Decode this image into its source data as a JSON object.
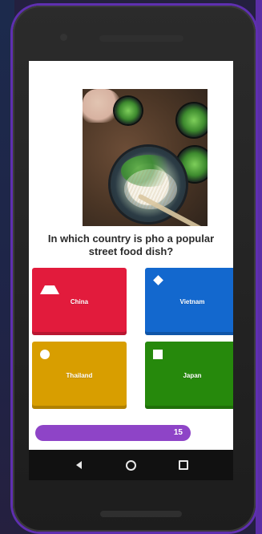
{
  "question": {
    "text": "In which country is pho a popular street food dish?"
  },
  "answers": [
    {
      "label": "China",
      "shape": "triangle",
      "color": "#e21b3c"
    },
    {
      "label": "Vietnam",
      "shape": "diamond",
      "color": "#1368ce"
    },
    {
      "label": "Thailand",
      "shape": "circle",
      "color": "#d89e00"
    },
    {
      "label": "Japan",
      "shape": "square",
      "color": "#26890c"
    }
  ],
  "timer": {
    "value": "15",
    "progress": 1.0,
    "color": "#8e44c7"
  },
  "nav": {
    "back_icon": "back-triangle-icon",
    "home_icon": "home-circle-icon",
    "recents_icon": "recents-square-icon"
  },
  "colors": {
    "frame_accent": "#5f2fb0",
    "background": "#24203f"
  }
}
